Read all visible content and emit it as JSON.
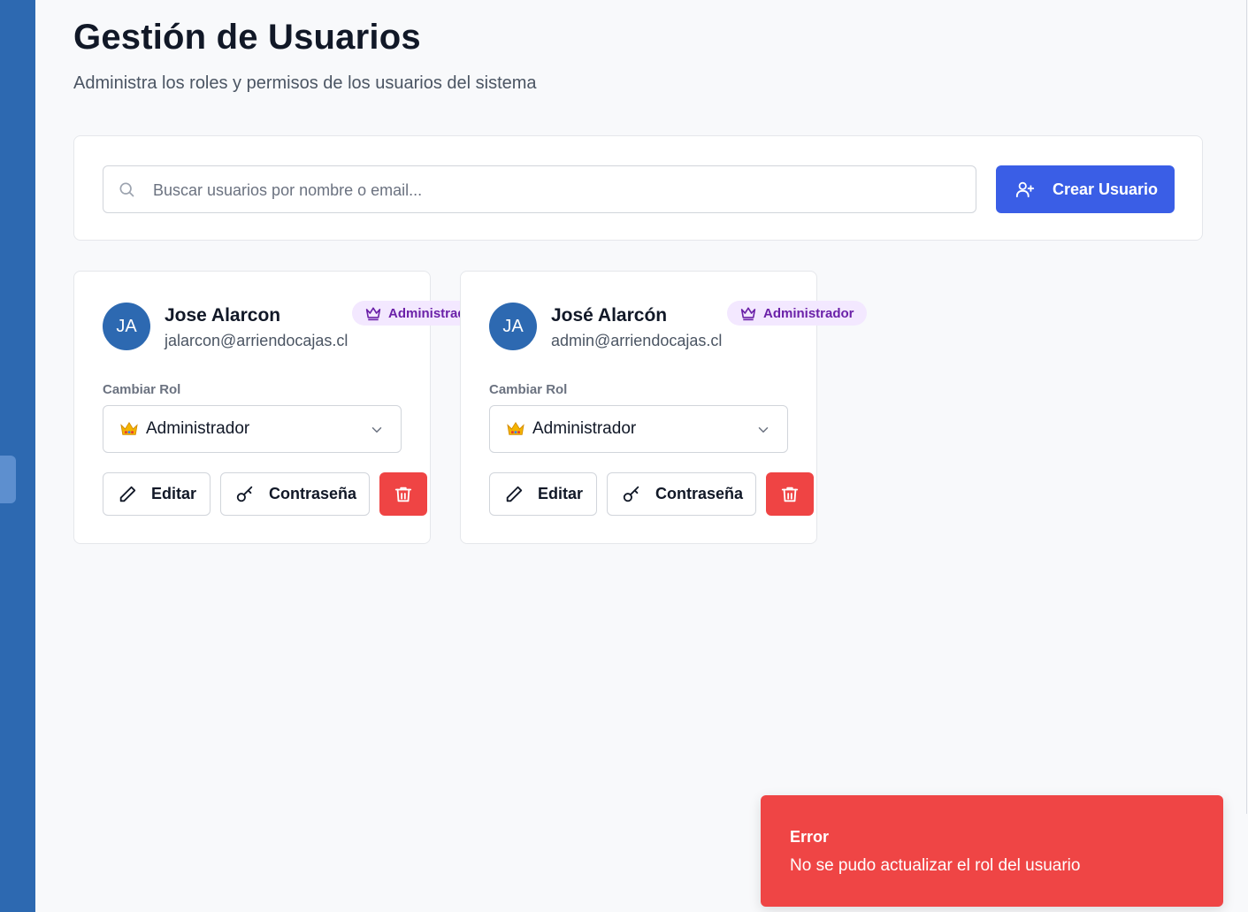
{
  "header": {
    "title": "Gestión de Usuarios",
    "subtitle": "Administra los roles y permisos de los usuarios del sistema"
  },
  "search": {
    "placeholder": "Buscar usuarios por nombre o email...",
    "value": "",
    "icon": "search-icon"
  },
  "toolbar": {
    "create_label": "Crear Usuario",
    "create_icon": "user-plus-icon"
  },
  "users": [
    {
      "initials": "JA",
      "name": "Jose Alarcon",
      "email": "jalarcon@arriendocajas.cl",
      "badge": "Administrador",
      "role_label": "Cambiar Rol",
      "role_value": "Administrador",
      "edit_label": "Editar",
      "password_label": "Contraseña"
    },
    {
      "initials": "JA",
      "name": "José Alarcón",
      "email": "admin@arriendocajas.cl",
      "badge": "Administrador",
      "role_label": "Cambiar Rol",
      "role_value": "Administrador",
      "edit_label": "Editar",
      "password_label": "Contraseña"
    }
  ],
  "toast": {
    "title": "Error",
    "message": "No se pudo actualizar el rol del usuario"
  },
  "colors": {
    "sidebar": "#2d69b1",
    "primary": "#3a5ee6",
    "danger": "#ef4444",
    "badge_bg": "#f3e8ff",
    "badge_text": "#6b21a8"
  }
}
